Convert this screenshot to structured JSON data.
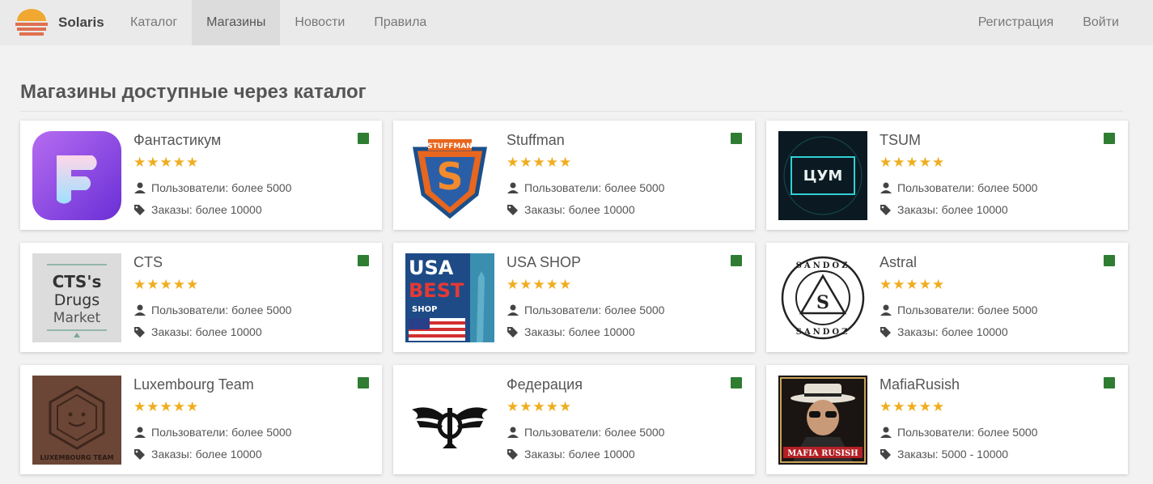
{
  "nav": {
    "brand": "Solaris",
    "items": [
      "Каталог",
      "Магазины",
      "Новости",
      "Правила"
    ],
    "active_index": 1,
    "register": "Регистрация",
    "login": "Войти"
  },
  "page": {
    "title": "Магазины доступные через каталог"
  },
  "colors": {
    "status": "#2e7d32",
    "stars": "#f0ad1e"
  },
  "shops": [
    {
      "name": "Фантастикум",
      "stars": "★★★★★",
      "users": "Пользователи: более 5000",
      "orders": "Заказы: более 10000",
      "logo_text": ""
    },
    {
      "name": "Stuffman",
      "stars": "★★★★★",
      "users": "Пользователи: более 5000",
      "orders": "Заказы: более 10000",
      "logo_text": "STUFFMAN"
    },
    {
      "name": "TSUM",
      "stars": "★★★★★",
      "users": "Пользователи: более 5000",
      "orders": "Заказы: более 10000",
      "logo_text": "ЦУМ"
    },
    {
      "name": "CTS",
      "stars": "★★★★★",
      "users": "Пользователи: более 5000",
      "orders": "Заказы: более 10000",
      "logo_text": "CTS's Drugs Market"
    },
    {
      "name": "USA SHOP",
      "stars": "★★★★★",
      "users": "Пользователи: более 5000",
      "orders": "Заказы: более 10000",
      "logo_text": "USA BEST SHOP"
    },
    {
      "name": "Astral",
      "stars": "★★★★★",
      "users": "Пользователи: более 5000",
      "orders": "Заказы: более 10000",
      "logo_text": "SANDOZ"
    },
    {
      "name": "Luxembourg Team",
      "stars": "★★★★★",
      "users": "Пользователи: более 5000",
      "orders": "Заказы: более 10000",
      "logo_text": "LUXEMBOURG TEAM"
    },
    {
      "name": "Федерация",
      "stars": "★★★★★",
      "users": "Пользователи: более 5000",
      "orders": "Заказы: более 10000",
      "logo_text": ""
    },
    {
      "name": "MafiaRusish",
      "stars": "★★★★★",
      "users": "Пользователи: более 5000",
      "orders": "Заказы: 5000 - 10000",
      "logo_text": "MAFIA RUSISH"
    }
  ]
}
